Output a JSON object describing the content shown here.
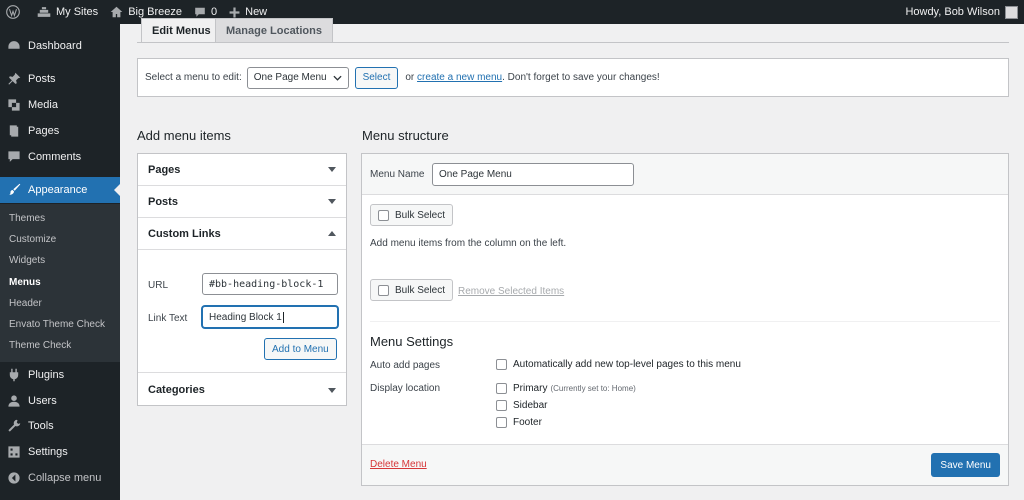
{
  "admin_bar": {
    "my_sites": "My Sites",
    "site_name": "Big Breeze",
    "comments_count": "0",
    "new_label": "New",
    "greeting": "Howdy, Bob Wilson"
  },
  "sidebar": {
    "items": [
      {
        "label": "Dashboard",
        "icon": "dashboard-icon"
      },
      {
        "label": "Posts",
        "icon": "pin-icon"
      },
      {
        "label": "Media",
        "icon": "media-icon"
      },
      {
        "label": "Pages",
        "icon": "pages-icon"
      },
      {
        "label": "Comments",
        "icon": "comment-icon"
      },
      {
        "label": "Appearance",
        "icon": "brush-icon"
      },
      {
        "label": "Plugins",
        "icon": "plug-icon"
      },
      {
        "label": "Users",
        "icon": "user-icon"
      },
      {
        "label": "Tools",
        "icon": "wrench-icon"
      },
      {
        "label": "Settings",
        "icon": "settings-icon"
      },
      {
        "label": "Collapse menu",
        "icon": "collapse-icon"
      }
    ],
    "submenu": [
      "Themes",
      "Customize",
      "Widgets",
      "Menus",
      "Header",
      "Envato Theme Check",
      "Theme Check"
    ],
    "current_submenu": "Menus"
  },
  "tabs": {
    "edit": "Edit Menus",
    "manage": "Manage Locations"
  },
  "manage_bar": {
    "prompt": "Select a menu to edit:",
    "selected_menu": "One Page Menu",
    "select_button": "Select",
    "or_text": "or",
    "create_link": "create a new menu",
    "suffix": ". Don't forget to save your changes!"
  },
  "add_items": {
    "title": "Add menu items",
    "sections": [
      "Pages",
      "Posts",
      "Custom Links",
      "Categories"
    ],
    "url_label": "URL",
    "url_value": "#bb-heading-block-1",
    "link_text_label": "Link Text",
    "link_text_value": "Heading Block 1",
    "add_button": "Add to Menu"
  },
  "structure": {
    "title": "Menu structure",
    "menu_name_label": "Menu Name",
    "menu_name_value": "One Page Menu",
    "bulk_select": "Bulk Select",
    "instructions": "Add menu items from the column on the left.",
    "remove_selected": "Remove Selected Items",
    "settings_title": "Menu Settings",
    "auto_add_label": "Auto add pages",
    "auto_add_option": "Automatically add new top-level pages to this menu",
    "display_location_label": "Display location",
    "locations": [
      {
        "name": "Primary",
        "note": "(Currently set to: Home)"
      },
      {
        "name": "Sidebar",
        "note": ""
      },
      {
        "name": "Footer",
        "note": ""
      }
    ],
    "delete_link": "Delete Menu",
    "save_button": "Save Menu"
  },
  "colors": {
    "accent": "#2271b1",
    "admin_dark": "#1d2327",
    "delete": "#d63638"
  }
}
